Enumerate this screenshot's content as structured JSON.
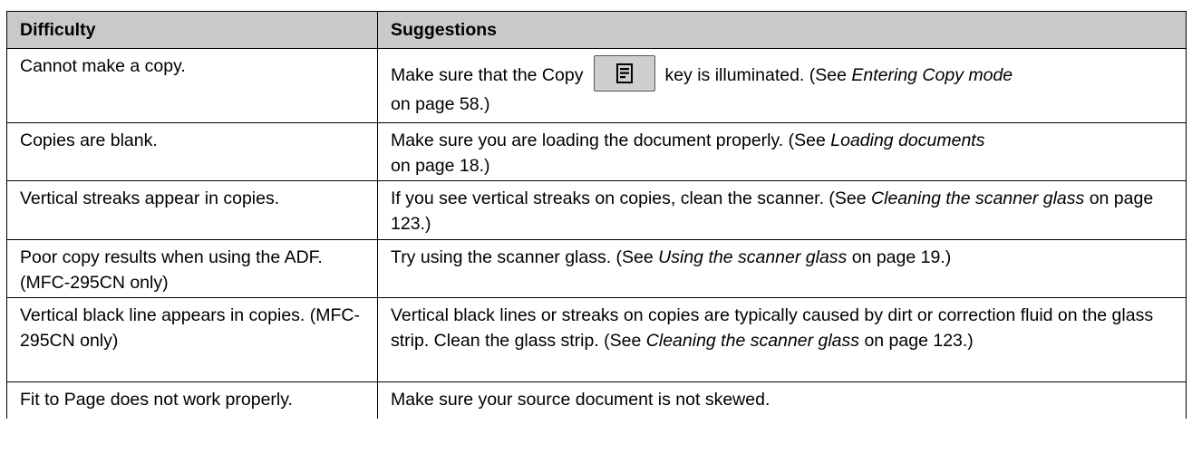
{
  "table": {
    "headers": [
      "Difficulty",
      "Suggestions"
    ],
    "rows": [
      {
        "difficulty": "Cannot make a copy.",
        "s_pre": "Make sure that the Copy",
        "s_mid": "key is illuminated. (See ",
        "s_em": "Entering Copy mode",
        "s_post": "on page 58.)"
      },
      {
        "difficulty": "Copies are blank.",
        "s_pre": "Make sure you are loading the document properly. (See ",
        "s_em": "Loading documents",
        "s_post": "on page 18.)"
      },
      {
        "difficulty": "Vertical streaks appear in copies.",
        "s_pre": "If you see vertical streaks on copies, clean the scanner. (See ",
        "s_em": "Cleaning the scanner glass",
        "s_post": " on page 123.)"
      },
      {
        "difficulty": "Poor copy results when using the ADF. (MFC-295CN only)",
        "s_pre": "Try using the scanner glass. (See ",
        "s_em": "Using the scanner glass",
        "s_post": " on page 19.)"
      },
      {
        "difficulty": "Vertical black line appears in copies. (MFC-295CN only)",
        "s_pre": "Vertical black lines or streaks on copies are typically caused by dirt or correction fluid on the glass strip. Clean the glass strip. (See ",
        "s_em": "Cleaning the scanner glass",
        "s_post": " on page 123.)"
      },
      {
        "difficulty": "Fit to Page does not work properly.",
        "s_pre": "Make sure your source document is not skewed."
      }
    ]
  },
  "icons": {
    "copy_key": "copy-key-icon"
  }
}
